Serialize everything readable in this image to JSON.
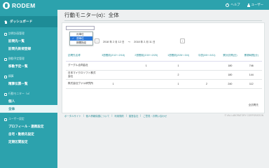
{
  "brand": {
    "name": "RODEM"
  },
  "topbar": {
    "help": "ヘルプ",
    "user": "ユーザー"
  },
  "sidebar": {
    "dashboard": "ダッシュボード",
    "sections": [
      {
        "title": "訪問計画管理",
        "items": [
          {
            "label": "訪問先一覧"
          },
          {
            "label": "訪問先新規登録"
          }
        ]
      },
      {
        "title": "移動予定管理",
        "items": [
          {
            "label": "移動予定一覧"
          }
        ]
      },
      {
        "title": "精算",
        "items": [
          {
            "label": "精算伝票一覧"
          }
        ]
      },
      {
        "title": "行動モニター（α）",
        "items": [
          {
            "label": "個人"
          },
          {
            "label": "全体"
          }
        ]
      },
      {
        "title": "ユーザー設定",
        "items": [
          {
            "label": "プロフィール・連携設定"
          },
          {
            "label": "自宅・勤務先設定"
          },
          {
            "label": "定期区間設定"
          }
        ]
      }
    ]
  },
  "main": {
    "title": "行動モニター(α)：全体",
    "view_select": {
      "options": [
        "月単位",
        "週単位",
        "期間指定"
      ],
      "selected": "週単位"
    },
    "date_from": "2018 年 2 月 12 日",
    "date_sep": "～",
    "date_to": "2018 年 2 月 11 日",
    "nav_prev": "‹",
    "nav_next": "›",
    "table": {
      "headers": [
        "訪問先名称",
        "3週間前(2/12～2/18)",
        "2週間前(2/19～2/25)",
        "1週間前(2/26～3/4)",
        "今週(3/5～3/11)",
        "累計訪問(日)",
        "累積時間(分)"
      ],
      "rows": [
        {
          "name": "グーグル合同会社",
          "cells": [
            "",
            "1",
            "1",
            "",
            "180",
            "746"
          ]
        },
        {
          "name": "日本マイクロソフト株式会社",
          "cells": [
            "",
            "",
            "2",
            "",
            "180",
            "144"
          ]
        },
        {
          "name": "株式会社ヴァル研究所",
          "cells": [
            "1",
            "",
            "1",
            "2",
            "240",
            "112"
          ]
        }
      ]
    },
    "more_link": "全訪問先"
  },
  "footer": {
    "links": [
      "ポータルサイト",
      "個人情報保護について",
      "利用規約",
      "運営会社",
      "ご意見・お問い合わせ"
    ],
    "separator": "|",
    "copyright": "© VAL LABORATORY CORPORATION"
  }
}
